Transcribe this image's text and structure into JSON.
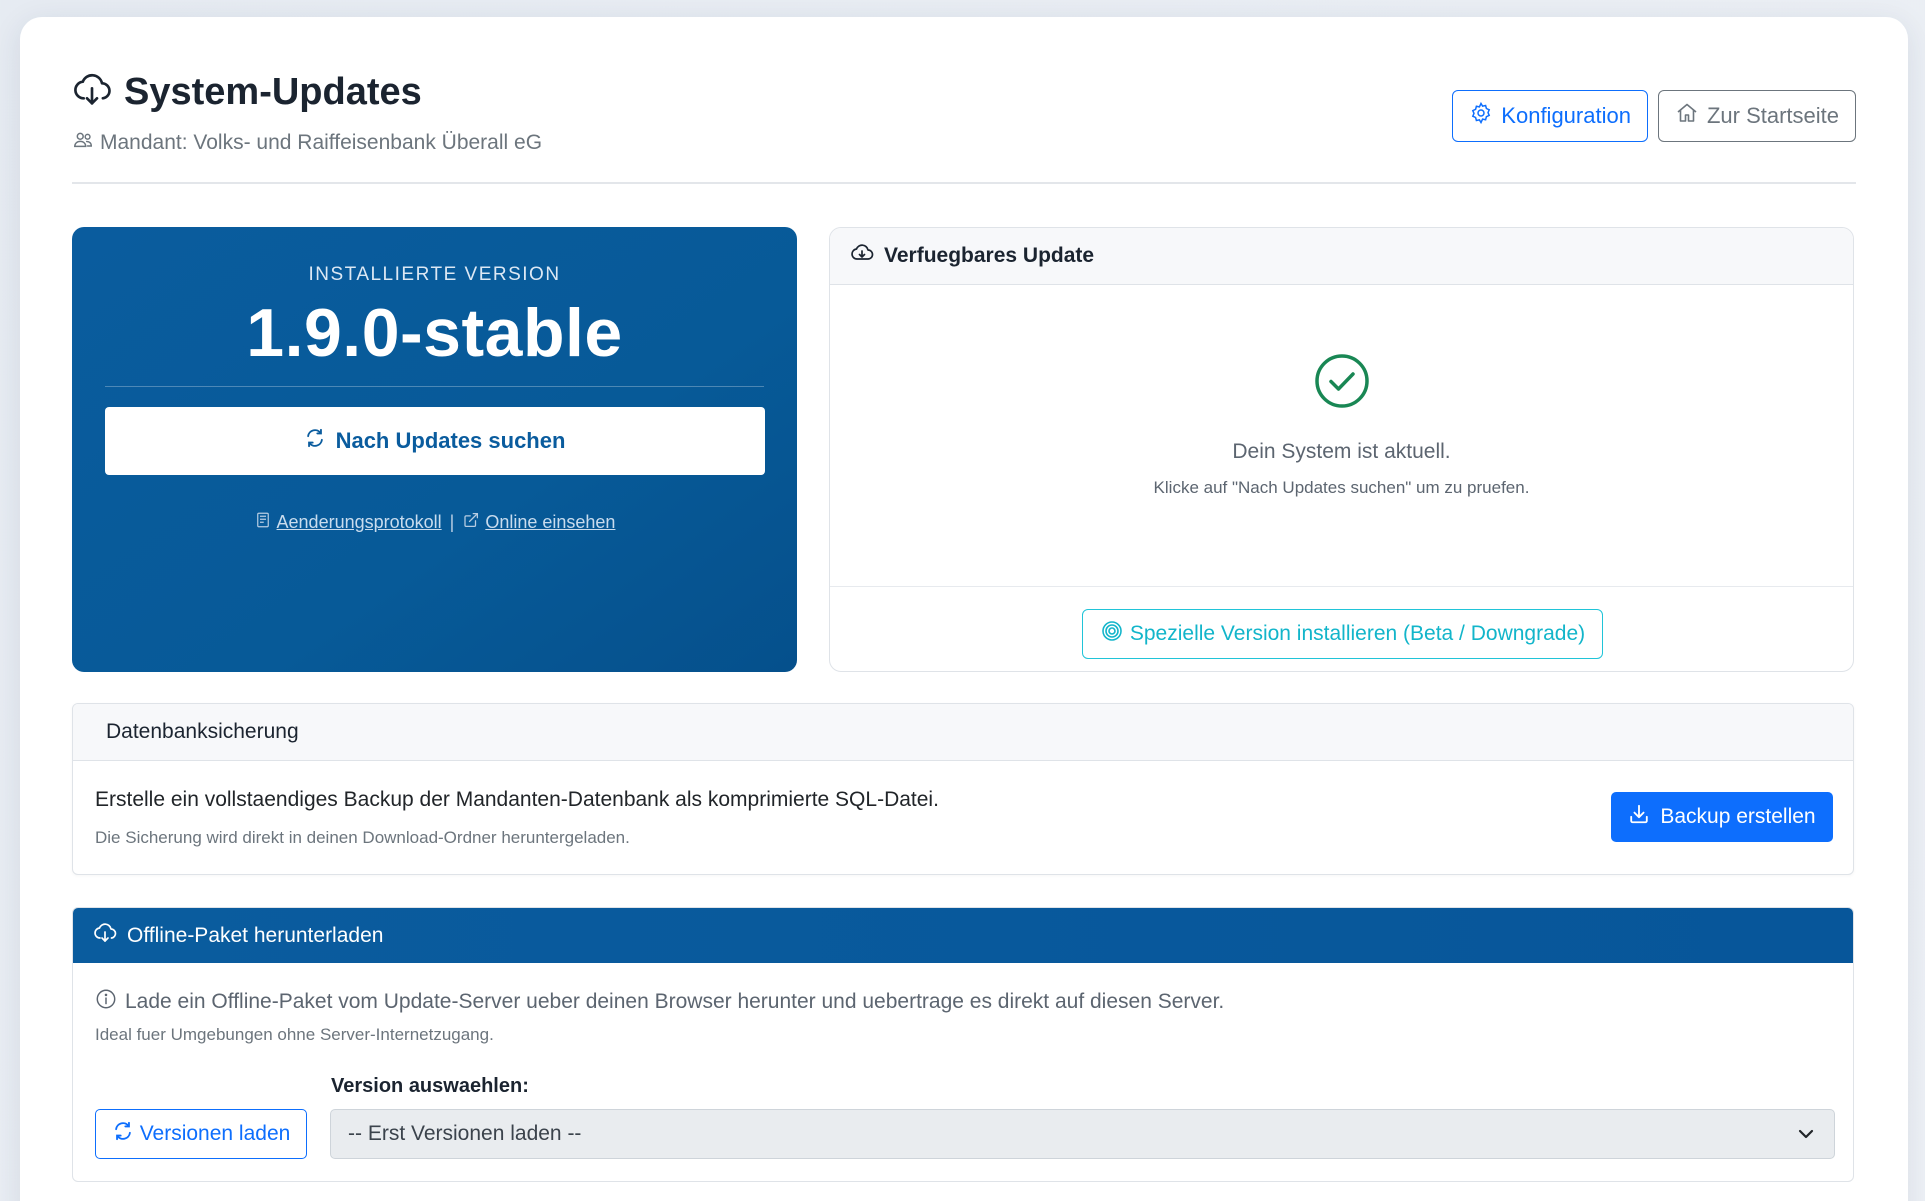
{
  "header": {
    "title": "System-Updates",
    "tenant": "Mandant: Volks- und Raiffeisenbank Überall eG",
    "config_label": "Konfiguration",
    "home_label": "Zur Startseite"
  },
  "installed": {
    "label": "INSTALLIERTE VERSION",
    "version": "1.9.0-stable",
    "check_label": "Nach Updates suchen",
    "changelog_label": "Aenderungsprotokoll",
    "separator": "|",
    "online_label": "Online einsehen"
  },
  "available_update": {
    "title": "Verfuegbares Update",
    "status": "Dein System ist aktuell.",
    "hint": "Klicke auf \"Nach Updates suchen\" um zu pruefen.",
    "special_label": "Spezielle Version installieren (Beta / Downgrade)"
  },
  "backup": {
    "title": "Datenbanksicherung",
    "text": "Erstelle ein vollstaendiges Backup der Mandanten-Datenbank als komprimierte SQL-Datei.",
    "subtext": "Die Sicherung wird direkt in deinen Download-Ordner heruntergeladen.",
    "button_label": "Backup erstellen"
  },
  "offline": {
    "title": "Offline-Paket herunterladen",
    "info": "Lade ein Offline-Paket vom Update-Server ueber deinen Browser herunter und uebertrage es direkt auf diesen Server.",
    "subtext": "Ideal fuer Umgebungen ohne Server-Internetzugang.",
    "load_label": "Versionen laden",
    "select_label": "Version auswaehlen:",
    "select_value": "-- Erst Versionen laden --"
  },
  "colors": {
    "brand_blue": "#0a5c9e",
    "primary": "#0d6efd",
    "success": "#198754",
    "info": "#12b5ca"
  },
  "icons": [
    "cloud-download-icon",
    "people-icon",
    "gear-icon",
    "house-icon",
    "refresh-icon",
    "journal-icon",
    "external-link-icon",
    "cloud-icon",
    "check-circle-icon",
    "target-icon",
    "download-icon",
    "info-icon",
    "chevron-down-icon"
  ]
}
